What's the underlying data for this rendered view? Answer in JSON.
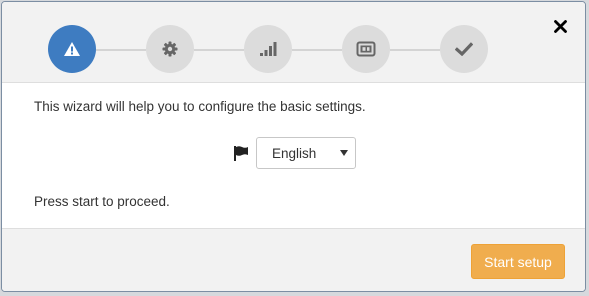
{
  "wizard": {
    "steps": [
      {
        "icon": "warning-icon",
        "active": true
      },
      {
        "icon": "gear-icon",
        "active": false
      },
      {
        "icon": "signal-bars-icon",
        "active": false
      },
      {
        "icon": "sd-card-icon",
        "active": false
      },
      {
        "icon": "checkmark-icon",
        "active": false
      }
    ],
    "close_icon": "close-icon"
  },
  "body": {
    "intro_text": "This wizard will help you to configure the basic settings.",
    "language_select": {
      "flag_icon": "flag-icon",
      "selected": "English"
    },
    "proceed_text": "Press start to proceed."
  },
  "footer": {
    "start_button_label": "Start setup"
  },
  "colors": {
    "active_step": "#3e7cc1",
    "inactive_step": "#dcdcdc",
    "primary_button": "#f0ad4e"
  }
}
